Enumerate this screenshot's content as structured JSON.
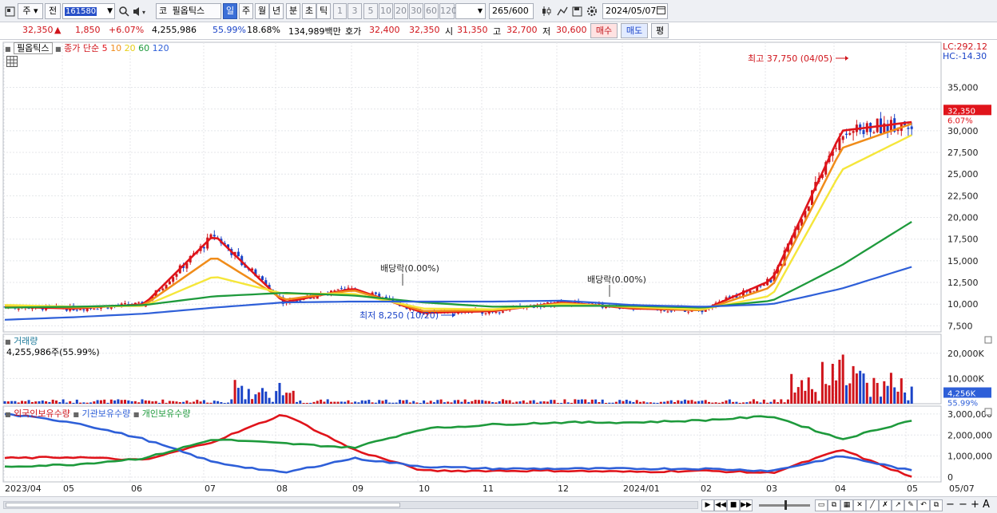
{
  "toolbar": {
    "market_type": "주",
    "prev_label": "전",
    "stock_code": "161580",
    "stock_prefix": "코",
    "stock_name": "필옵틱스",
    "periods": [
      "일",
      "주",
      "월",
      "년",
      "분",
      "초",
      "틱"
    ],
    "selected_period": "일",
    "intervals": [
      "1",
      "3",
      "5",
      "10",
      "20",
      "30",
      "60",
      "120"
    ],
    "count": "265",
    "count_max": "/600",
    "date": "2024/05/07"
  },
  "quote": {
    "price": "32,350",
    "change_arrow": "▲",
    "change": "1,850",
    "change_pct": "+6.07%",
    "volume": "4,255,986",
    "volume_ratio": "55.99%",
    "turnover": "18.68%",
    "amount": "134,989백만",
    "bid_label": "호가",
    "bid": "32,400",
    "ask": "32,350",
    "open_label": "시",
    "open": "31,350",
    "high_label": "고",
    "high": "32,700",
    "low_label": "저",
    "low": "30,600",
    "buy_label": "매수",
    "sell_label": "매도",
    "eval_label": "평"
  },
  "price_panel": {
    "stock_tag": "필옵틱스",
    "ma_prefix": "종가 단순",
    "ma_periods": [
      "5",
      "10",
      "20",
      "60",
      "120"
    ],
    "lc": "LC:292.12",
    "hc": "HC:-14.30",
    "current_price_badge": "32,350",
    "current_change_badge": "6.07%",
    "high_annotation": "최고 37,750 (04/05)",
    "low_annotation": "최저 8,250 (10/20)",
    "dividend_annotations": [
      "배당락(0.00%)",
      "배당락(0.00%)"
    ],
    "y_ticks": [
      "35,000",
      "32,500",
      "30,000",
      "27,500",
      "25,000",
      "22,500",
      "20,000",
      "17,500",
      "15,000",
      "12,500",
      "10,000",
      "7,500"
    ]
  },
  "volume_panel": {
    "title": "거래량",
    "value": "4,255,986주(55.99%)",
    "y_ticks": [
      "20,000K",
      "10,000K"
    ],
    "current_badge": "4,256K",
    "current_pct": "55.99%"
  },
  "holdings_panel": {
    "series_names": [
      "외국인보유수량",
      "기관보유수량",
      "개인보유수량"
    ],
    "y_ticks": [
      "3,000,000",
      "2,000,000",
      "1,000,000",
      "0"
    ]
  },
  "x_axis": {
    "labels": [
      "2023/04",
      "05",
      "06",
      "07",
      "08",
      "09",
      "10",
      "11",
      "12",
      "2024/01",
      "02",
      "03",
      "04",
      "05"
    ],
    "right_label": "05/07"
  },
  "colors": {
    "up": "#d0141b",
    "down": "#1b44c8",
    "ma5": "#e0141b",
    "ma10": "#f08c1a",
    "ma20": "#f5e63a",
    "ma60": "#1e9a3c",
    "ma120": "#2e5fd8",
    "foreign": "#e0141b",
    "institution": "#2e5fd8",
    "individual": "#1e9a3c"
  },
  "chart_data": {
    "type": "line",
    "x": [
      "2023/04",
      "05",
      "06",
      "07",
      "08",
      "09",
      "10",
      "11",
      "12",
      "2024/01",
      "02",
      "03",
      "04",
      "05"
    ],
    "ylim": [
      7500,
      37750
    ],
    "series": [
      {
        "name": "5",
        "values": [
          9700,
          9500,
          10000,
          18000,
          10200,
          11800,
          9000,
          9200,
          10200,
          9500,
          9300,
          12800,
          30000,
          31000
        ]
      },
      {
        "name": "10",
        "values": [
          9800,
          9600,
          9900,
          15500,
          10500,
          11600,
          9200,
          9300,
          10100,
          9600,
          9300,
          12000,
          28000,
          30800
        ]
      },
      {
        "name": "20",
        "values": [
          9900,
          9700,
          9800,
          13200,
          11200,
          11200,
          9500,
          9400,
          10000,
          9700,
          9400,
          11000,
          25500,
          29500
        ]
      },
      {
        "name": "60",
        "values": [
          9600,
          9700,
          9900,
          10900,
          11300,
          11000,
          10200,
          9700,
          9800,
          9800,
          9600,
          10400,
          14500,
          19500
        ]
      },
      {
        "name": "120",
        "values": [
          8200,
          8500,
          8900,
          9600,
          10200,
          10300,
          10300,
          10300,
          10400,
          9900,
          9700,
          10000,
          11800,
          14300
        ]
      }
    ]
  }
}
